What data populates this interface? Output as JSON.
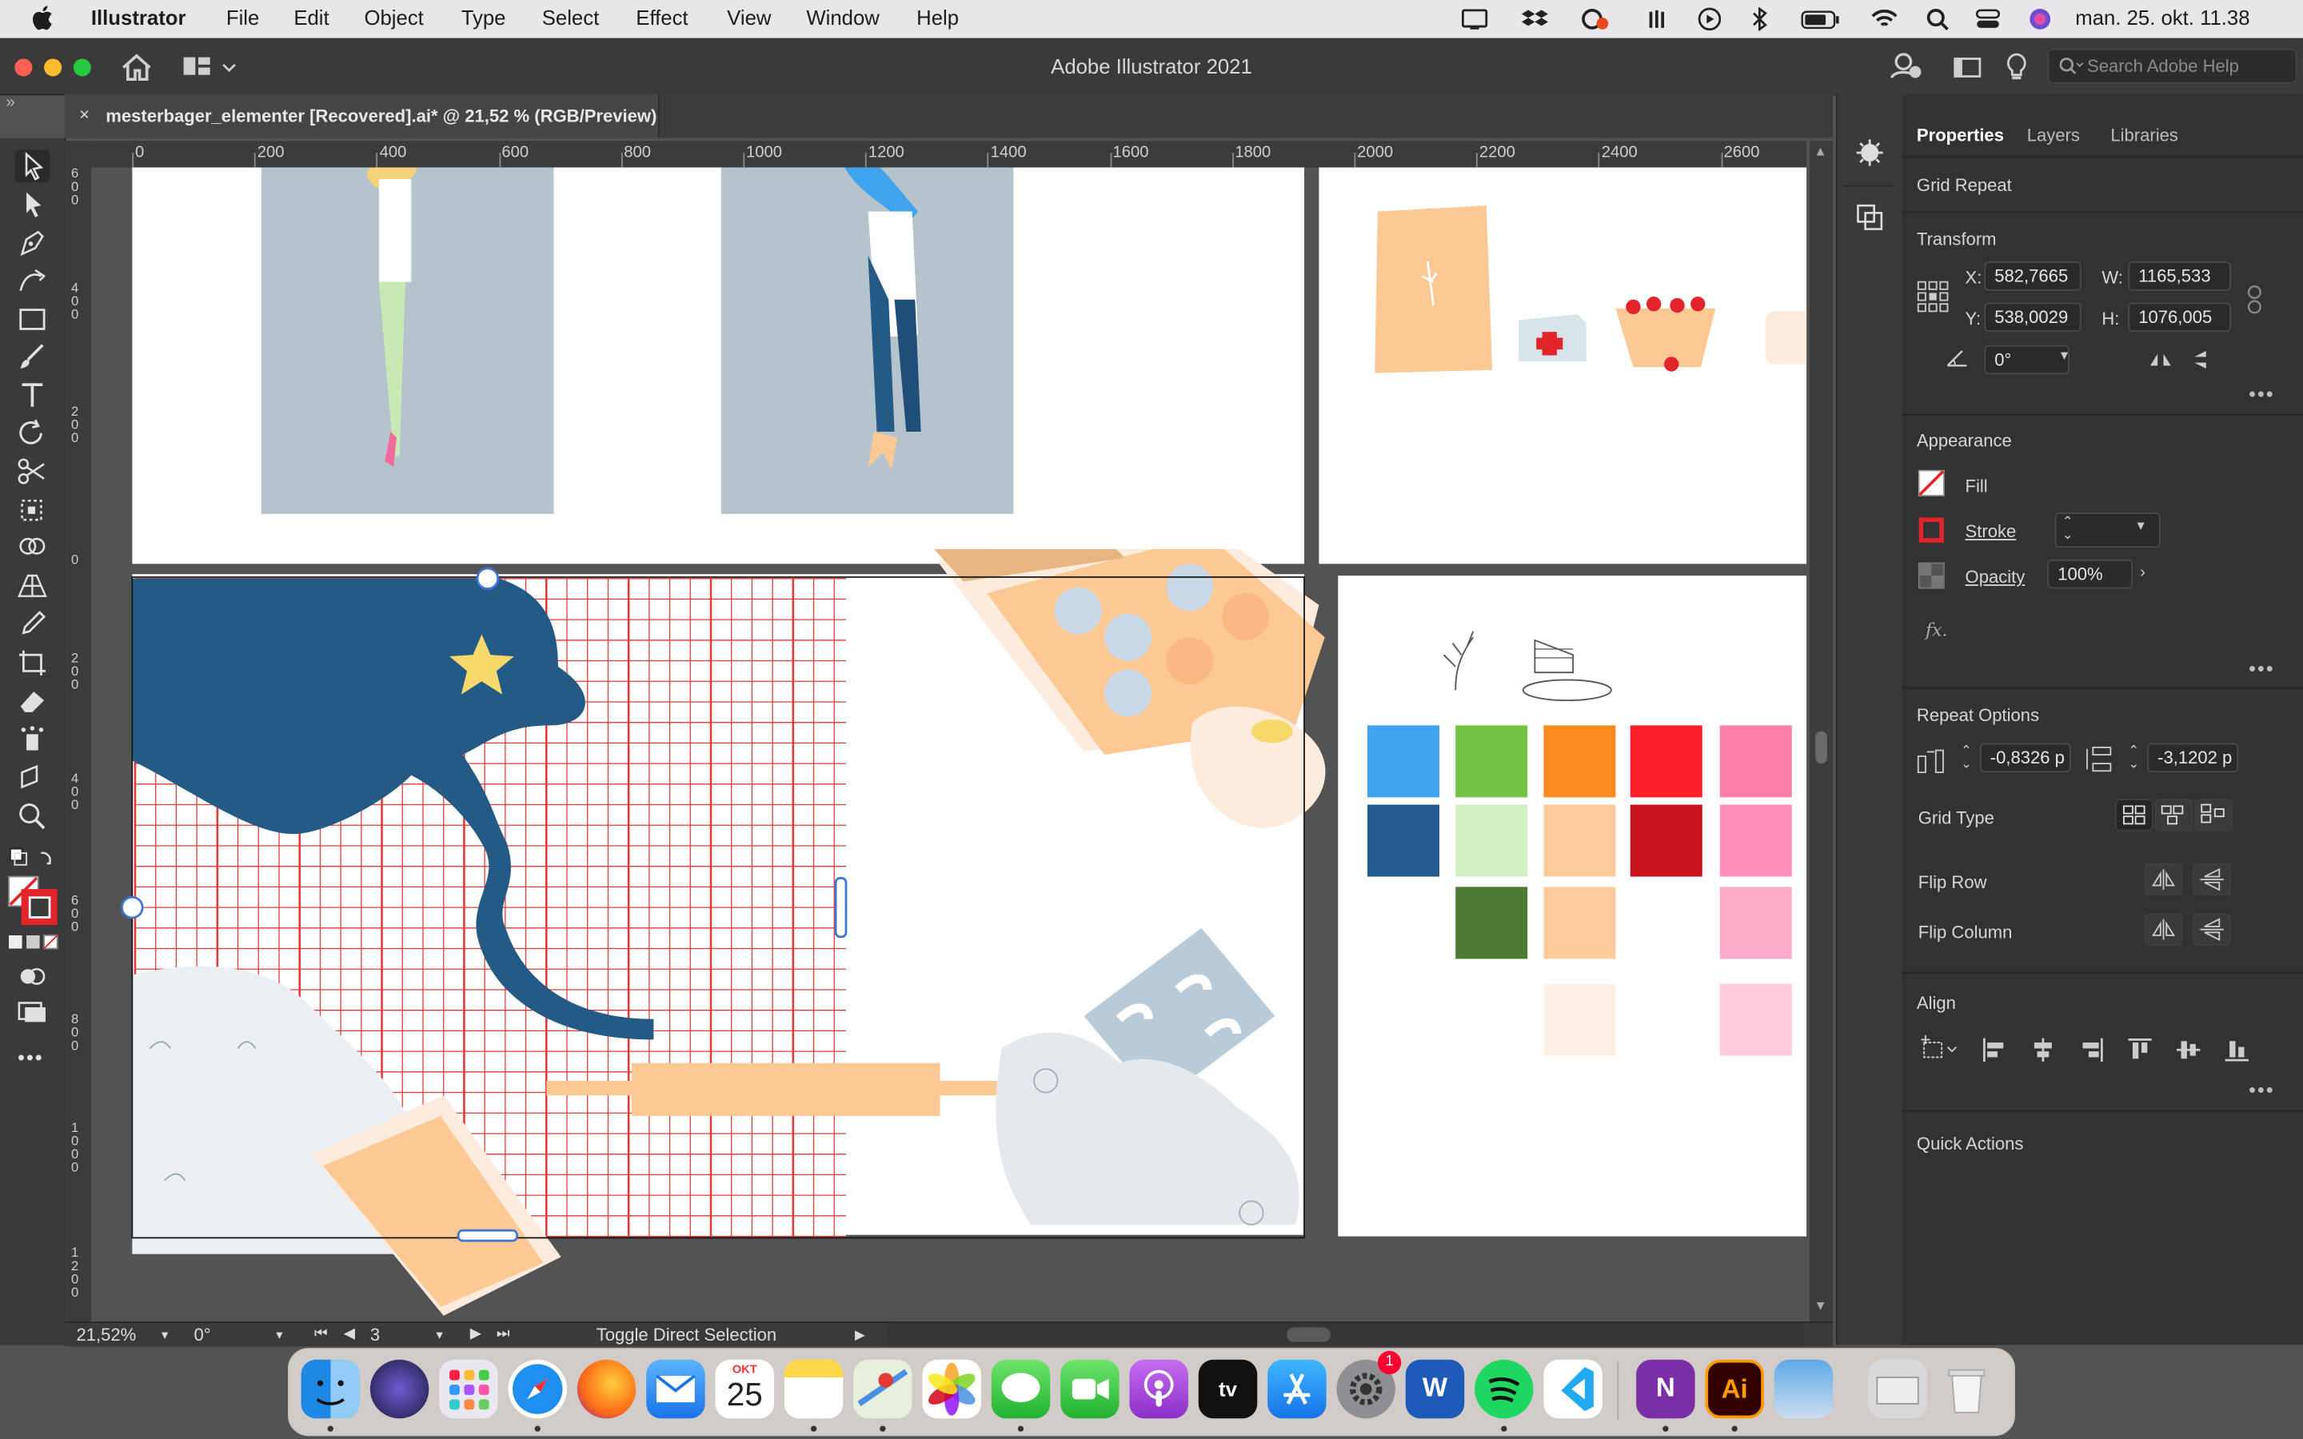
{
  "menubar": {
    "apple": "",
    "app_name": "Illustrator",
    "items": [
      "File",
      "Edit",
      "Object",
      "Type",
      "Select",
      "Effect",
      "View",
      "Window",
      "Help"
    ],
    "clock": "man. 25. okt.  11.38"
  },
  "window": {
    "title": "Adobe Illustrator 2021",
    "search_placeholder": "Search Adobe Help"
  },
  "document": {
    "tab_label": "mesterbager_elementer [Recovered].ai* @ 21,52 % (RGB/Preview)",
    "close_glyph": "×"
  },
  "rulers": {
    "horizontal_ticks": [
      "0",
      "200",
      "400",
      "600",
      "800",
      "1000",
      "1200",
      "1400",
      "1600",
      "1800",
      "2000",
      "2200",
      "2400",
      "2600"
    ],
    "vertical_ticks": [
      "600",
      "400",
      "200",
      "0",
      "200",
      "400",
      "600",
      "800",
      "1000",
      "1200"
    ]
  },
  "status": {
    "zoom": "21,52%",
    "rotation": "0°",
    "artboard_number": "3",
    "hint": "Toggle Direct Selection"
  },
  "panels": {
    "tabs": [
      "Properties",
      "Layers",
      "Libraries"
    ],
    "active_tab": "Properties",
    "selection_type": "Grid Repeat",
    "transform": {
      "title": "Transform",
      "x_label": "X:",
      "x": "582,7665",
      "y_label": "Y:",
      "y": "538,0029",
      "w_label": "W:",
      "w": "1165,533",
      "h_label": "H:",
      "h": "1076,005",
      "angle": "0°"
    },
    "appearance": {
      "title": "Appearance",
      "fill_label": "Fill",
      "stroke_label": "Stroke",
      "opacity_label": "Opacity",
      "opacity": "100%",
      "fx_label": "fx."
    },
    "repeat_options": {
      "title": "Repeat Options",
      "h_spacing": "-0,8326 p",
      "v_spacing": "-3,1202 p",
      "grid_type_label": "Grid Type",
      "flip_row_label": "Flip Row",
      "flip_column_label": "Flip Column"
    },
    "align": {
      "title": "Align"
    },
    "quick_actions": {
      "title": "Quick Actions"
    }
  },
  "swatches": {
    "row1": [
      "#3fa3ee",
      "#73c243",
      "#fb8a1f",
      "#fd1f2a",
      "#ff7fa9"
    ],
    "row2": [
      "#235c8e",
      "#d2eec3",
      "#fecb9c",
      "#c6131f",
      "#ff8fb8"
    ],
    "row3": [
      "#4e7a34",
      "#fecb9c",
      "#ffabca"
    ],
    "row4": [
      "#fff0e6",
      "#ffcade"
    ]
  },
  "dock": {
    "calendar_month": "OKT",
    "calendar_day": "25",
    "badge_count": "1",
    "illustrator_label": "Ai",
    "word_label": "W",
    "onenote_label": "N",
    "appletv_label": "tv"
  },
  "colors": {
    "accent_blue": "#3c75d6",
    "selection_blue": "#2f6bd6",
    "navy": "#245a86",
    "peach": "#fcc994",
    "grid_red": "#e23a3a"
  }
}
